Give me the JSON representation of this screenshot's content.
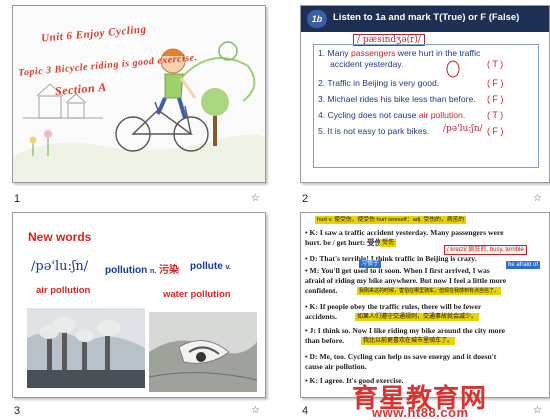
{
  "slide1": {
    "number": "1",
    "title_line1": "Unit 6 Enjoy Cycling",
    "title_line2": "Topic 3 Bicycle riding is good exercise.",
    "title_line3": "Section A"
  },
  "slide2": {
    "number": "2",
    "badge": "1b",
    "instruction": "Listen to 1a and mark T(True) or F (False)",
    "phonetic_top": "/ pæsindʒə(r)/",
    "items": [
      {
        "pre": "1.  Many ",
        "hl": "passengers",
        "post": " were hurt in the traffic",
        "cont": "accident yesterday.",
        "mark": "( T )"
      },
      {
        "pre": "2.  Traffic in Beijing is very good.",
        "hl": "",
        "post": "",
        "cont": "",
        "mark": "( F )"
      },
      {
        "pre": "3.  Michael rides his bike less than before.",
        "hl": "",
        "post": "",
        "cont": "",
        "mark": "( F )"
      },
      {
        "pre": "4.  Cycling does not cause ",
        "hl": "air pollution",
        "post": ".",
        "cont": "",
        "mark": "( T )"
      },
      {
        "pre": "5.  It is not easy to park bikes.",
        "hl": "",
        "post": "",
        "cont": "",
        "mark": "( F )"
      }
    ],
    "phonetic_bottom": "/pə'lu:ʃn/"
  },
  "slide3": {
    "number": "3",
    "heading": "New words",
    "phonetic": "/pə'lu:ʃn/",
    "word_pollution": "pollution",
    "pos_n": "n.",
    "cn_pollution": "污染",
    "word_pollute": "pollute",
    "pos_v": "v.",
    "air": "air pollution",
    "water": "water pollution"
  },
  "slide4": {
    "number": "4",
    "lines": [
      {
        "t": "hurt v. 使受伤，使受伤 hurt oneself：adj. 受伤的，病苦的",
        "cls": "tiny"
      },
      {
        "t": "• K: I saw a traffic accident yesterday. Many passengers were"
      },
      {
        "t": "  hurt.      be / get hurt: 受伤"
      },
      {
        "t": "• D: That's terrible! I think traffic in Beijing is crazy."
      },
      {
        "t": "• M: You'll get used to it soon. When I first arrived, I was"
      },
      {
        "t": "  afraid of riding my bike anywhere. But now I feel a little more"
      },
      {
        "t": "  confident."
      },
      {
        "t": "• K: If people obey the traffic rules, there will be fewer"
      },
      {
        "t": "  accidents."
      },
      {
        "t": "• J: I think so. Now I like riding my bike around the city more"
      },
      {
        "t": "  than before."
      },
      {
        "t": "• D: Me, too. Cycling can help us save energy and it doesn't"
      },
      {
        "t": "  cause air pollution."
      },
      {
        "t": "• K: I agree. It's good exercise."
      }
    ],
    "tag_crazy": "/ kreɪzi/ 疯狂的, busy, terrible",
    "tag_afraid": "be afraid of",
    "tag_used": "习惯于",
    "tag_hurt": "受伤",
    "tag_rules": "如果人们遵守交通规则，交通事故就会减少。",
    "tag_conf": "我刚来这的时候，害怕在哪里骑车，但现在我感到有点自信了。",
    "tag_city": "我比以前更喜欢在城市里骑车了。"
  },
  "watermark": {
    "cn": "育星教育网",
    "url": "www.ht88.com"
  },
  "star": "☆"
}
